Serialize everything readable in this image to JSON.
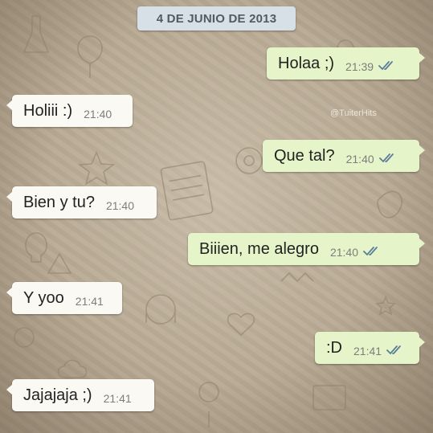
{
  "date_label": "4 DE JUNIO DE 2013",
  "watermark": "@TuiterHits",
  "colors": {
    "incoming_bubble": "#fbf9f4",
    "outgoing_bubble": "#e6f5c9",
    "read_ticks": "#5b7d9a",
    "date_pill": "#d7e0e6"
  },
  "messages": [
    {
      "text": "Holaa ;)",
      "time": "21:39",
      "direction": "out",
      "status": "read-ticks-icon"
    },
    {
      "text": "Holiii :)",
      "time": "21:40",
      "direction": "in"
    },
    {
      "text": "Que tal?",
      "time": "21:40",
      "direction": "out",
      "status": "read-ticks-icon"
    },
    {
      "text": "Bien y tu?",
      "time": "21:40",
      "direction": "in"
    },
    {
      "text": "Biiien, me alegro",
      "time": "21:40",
      "direction": "out",
      "status": "read-ticks-icon"
    },
    {
      "text": "Y yoo",
      "time": "21:41",
      "direction": "in"
    },
    {
      "text": ":D",
      "time": "21:41",
      "direction": "out",
      "status": "read-ticks-icon"
    },
    {
      "text": "Jajajaja ;)",
      "time": "21:41",
      "direction": "in"
    }
  ]
}
